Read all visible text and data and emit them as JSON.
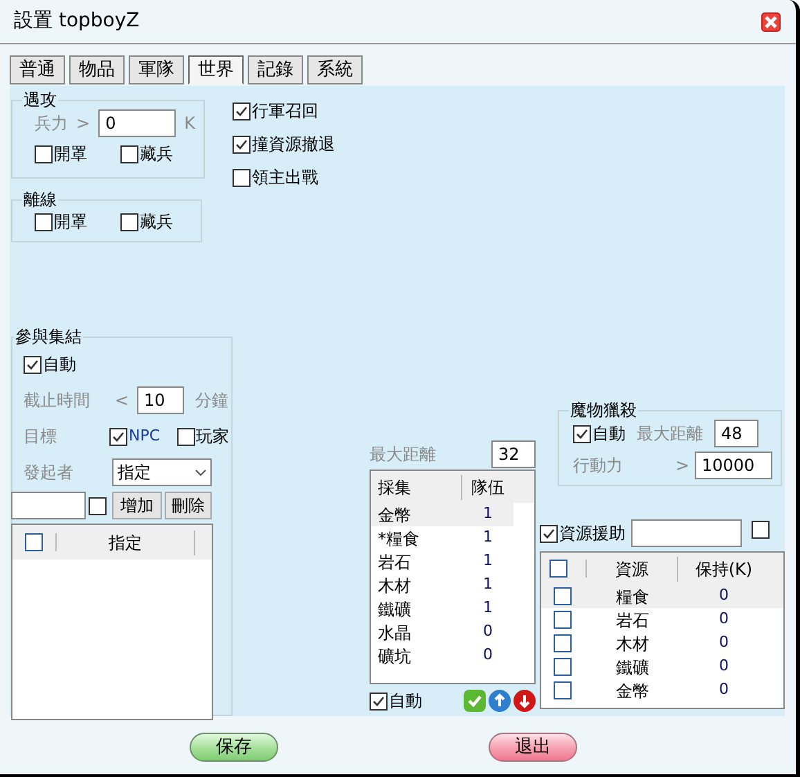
{
  "window": {
    "title": "設置 topboyZ"
  },
  "tabs": [
    {
      "label": "普通",
      "selected": false
    },
    {
      "label": "物品",
      "selected": false
    },
    {
      "label": "軍隊",
      "selected": false
    },
    {
      "label": "世界",
      "selected": true
    },
    {
      "label": "記錄",
      "selected": false
    },
    {
      "label": "系統",
      "selected": false
    }
  ],
  "attack_group": {
    "title": "遇攻",
    "troop_label": "兵力",
    "comparator": ">",
    "troop_value": "0",
    "unit": "K",
    "options": [
      {
        "label": "開罩",
        "checked": false
      },
      {
        "label": "藏兵",
        "checked": false
      }
    ]
  },
  "offline_group": {
    "title": "離線",
    "options": [
      {
        "label": "開罩",
        "checked": false
      },
      {
        "label": "藏兵",
        "checked": false
      }
    ]
  },
  "march_options": [
    {
      "label": "行軍召回",
      "checked": true
    },
    {
      "label": "撞資源撤退",
      "checked": true
    },
    {
      "label": "領主出戰",
      "checked": false
    }
  ],
  "rally_group": {
    "title": "參與集結",
    "auto": {
      "label": "自動",
      "checked": true
    },
    "deadline_label": "截止時間",
    "deadline_comparator": "<",
    "deadline_value": "10",
    "deadline_unit": "分鐘",
    "target_label": "目標",
    "targets": [
      {
        "label": "NPC",
        "checked": true
      },
      {
        "label": "玩家",
        "checked": false
      }
    ],
    "initiator_label": "發起者",
    "initiator_value": "指定",
    "add_checked": false,
    "add_button": "增加",
    "delete_button": "刪除",
    "list": {
      "header_checked": false,
      "column": "指定"
    }
  },
  "gather": {
    "max_distance_label": "最大距離",
    "max_distance": "32",
    "columns": [
      "採集",
      "隊伍"
    ],
    "rows": [
      {
        "resource": "金幣",
        "teams": "1",
        "selected": true
      },
      {
        "resource": "*糧食",
        "teams": "1",
        "selected": false
      },
      {
        "resource": "岩石",
        "teams": "1",
        "selected": false
      },
      {
        "resource": "木材",
        "teams": "1",
        "selected": false
      },
      {
        "resource": "鐵礦",
        "teams": "1",
        "selected": false
      },
      {
        "resource": "水晶",
        "teams": "0",
        "selected": false
      },
      {
        "resource": "礦坑",
        "teams": "0",
        "selected": false
      }
    ],
    "auto": {
      "label": "自動",
      "checked": true
    }
  },
  "monster_hunt": {
    "title": "魔物獵殺",
    "auto": {
      "label": "自動",
      "checked": true
    },
    "max_distance_label": "最大距離",
    "max_distance": "48",
    "stamina_label": "行動力",
    "comparator": ">",
    "stamina": "10000"
  },
  "resource_aid": {
    "label": "資源援助",
    "checked": true,
    "extra_checked": false,
    "header_checked": false,
    "columns": [
      "資源",
      "保持(K)"
    ],
    "rows": [
      {
        "checked": false,
        "resource": "糧食",
        "keep": "0",
        "selected": true
      },
      {
        "checked": false,
        "resource": "岩石",
        "keep": "0",
        "selected": false
      },
      {
        "checked": false,
        "resource": "木材",
        "keep": "0",
        "selected": false
      },
      {
        "checked": false,
        "resource": "鐵礦",
        "keep": "0",
        "selected": false
      },
      {
        "checked": false,
        "resource": "金幣",
        "keep": "0",
        "selected": false
      }
    ]
  },
  "buttons": [
    {
      "label": "保存",
      "kind": "save"
    },
    {
      "label": "退出",
      "kind": "exit"
    }
  ]
}
